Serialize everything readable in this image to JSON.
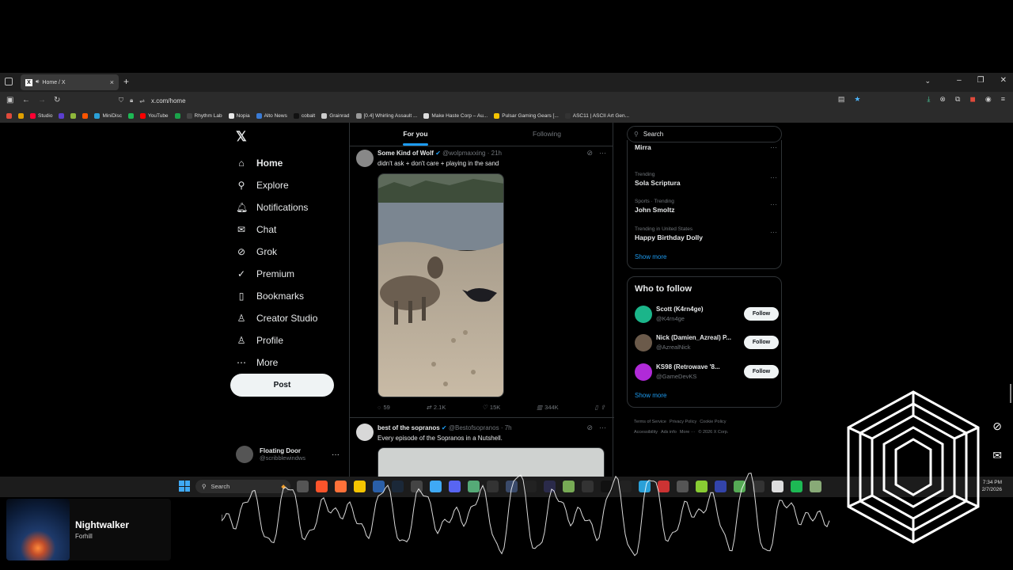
{
  "browser": {
    "tab_title": "Home / X",
    "tab_close": "×",
    "new_tab": "+",
    "url": "x.com/home",
    "bookmarks": [
      {
        "label": "",
        "color": "#e04a3b"
      },
      {
        "label": "",
        "color": "#e0a000"
      },
      {
        "label": "Studio",
        "color": "#ff0033"
      },
      {
        "label": "",
        "color": "#5b3fcf"
      },
      {
        "label": "",
        "color": "#8fb83b"
      },
      {
        "label": "",
        "color": "#ff5500"
      },
      {
        "label": "MiniDisc",
        "color": "#2aa0d8"
      },
      {
        "label": "",
        "color": "#1db954"
      },
      {
        "label": "YouTube",
        "color": "#ff0000"
      },
      {
        "label": "",
        "color": "#1aa34a"
      },
      {
        "label": "Rhythm Lab",
        "color": "#444"
      },
      {
        "label": "Nopia",
        "color": "#e8e8e8"
      },
      {
        "label": "Alto News",
        "color": "#3a7bd5"
      },
      {
        "label": "cobalt",
        "color": "#111"
      },
      {
        "label": "Grainrad",
        "color": "#ccc"
      },
      {
        "label": "[0.4] Whirling Assault ...",
        "color": "#999"
      },
      {
        "label": "Make Haste Corp – Au...",
        "color": "#ddd"
      },
      {
        "label": "Pulsar Gaming Gears [...",
        "color": "#f5c400"
      },
      {
        "label": "ASC11 | ASCII Art Gen...",
        "color": "#333"
      }
    ]
  },
  "x": {
    "logo": "𝕏",
    "nav": [
      {
        "label": "Home",
        "icon": "⌂",
        "name": "home"
      },
      {
        "label": "Explore",
        "icon": "⚲",
        "name": "explore"
      },
      {
        "label": "Notifications",
        "icon": "🔔︎",
        "name": "notifications"
      },
      {
        "label": "Chat",
        "icon": "✉",
        "name": "chat"
      },
      {
        "label": "Grok",
        "icon": "⊘",
        "name": "grok"
      },
      {
        "label": "Premium",
        "icon": "✓",
        "name": "premium"
      },
      {
        "label": "Bookmarks",
        "icon": "▯",
        "name": "bookmarks"
      },
      {
        "label": "Creator Studio",
        "icon": "♙",
        "name": "creator-studio"
      },
      {
        "label": "Profile",
        "icon": "♙",
        "name": "profile"
      },
      {
        "label": "More",
        "icon": "⋯",
        "name": "more"
      }
    ],
    "post_label": "Post",
    "account": {
      "name": "Floating Door",
      "handle": "@scribblewindws",
      "more": "···"
    },
    "tabs": {
      "for_you": "For you",
      "following": "Following"
    },
    "tweet1": {
      "name": "Some Kind of Wolf",
      "handle": "@wolpmaxxing",
      "time": "· 21h",
      "text": "didn't ask + don't care + playing in the sand",
      "replies": "59",
      "reposts": "2.1K",
      "likes": "15K",
      "views": "344K"
    },
    "tweet2": {
      "name": "best of the sopranos",
      "handle": "@Bestofsopranos",
      "time": "· 7h",
      "text": "Every episode of the Sopranos in a Nutshell."
    },
    "search_placeholder": "Search",
    "trends": [
      {
        "category": "",
        "name": "Mirra"
      },
      {
        "category": "Trending",
        "name": "Sola Scriptura"
      },
      {
        "category": "Sports · Trending",
        "name": "John Smoltz"
      },
      {
        "category": "Trending in United States",
        "name": "Happy Birthday Dolly"
      }
    ],
    "show_more": "Show more",
    "who_to_follow": "Who to follow",
    "follow_label": "Follow",
    "suggestions": [
      {
        "name": "Scott (K4rn4ge)",
        "handle": "@K4rn4ge",
        "color": "#1bb58a"
      },
      {
        "name": "Nick (Damien_Azreal) P...",
        "handle": "@AzrealNick",
        "color": "#6b5a4a"
      },
      {
        "name": "KS98 (Retrowave '8...",
        "handle": "@GameDevKS",
        "color": "#b02ad8"
      }
    ],
    "footer": [
      "Terms of Service",
      "Privacy Policy",
      "Cookie Policy",
      "Accessibility",
      "Ads info",
      "More ···",
      "© 2026 X Corp."
    ]
  },
  "taskbar": {
    "search": "Search",
    "time": "7:34 PM",
    "date": "2/7/2026"
  },
  "music": {
    "song": "Nightwalker",
    "artist": "Forhill"
  }
}
